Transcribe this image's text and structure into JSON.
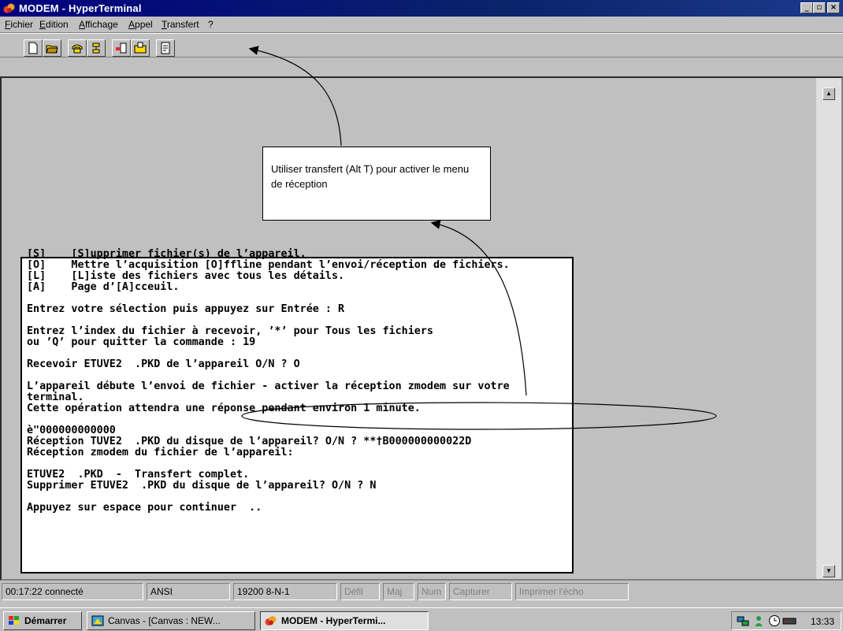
{
  "window": {
    "title": "MODEM - HyperTerminal",
    "controls": {
      "minimize": "_",
      "restore": "▫",
      "close": "×"
    }
  },
  "menu": {
    "items": [
      "Fichier",
      "Edition",
      "Affichage",
      "Appel",
      "Transfert",
      "?"
    ]
  },
  "toolbar": {
    "buttons": [
      "new-icon",
      "open-icon",
      "call-icon",
      "disconnect-icon",
      "send-icon",
      "receive-icon",
      "properties-icon"
    ]
  },
  "terminal": {
    "lines": [
      "[S]    [S]upprimer fichier(s) de l’appareil.",
      "[O]    Mettre l’acquisition [O]ffline pendant l’envoi/réception de fichiers.",
      "[L]    [L]iste des fichiers avec tous les détails.",
      "[A]    Page d’[A]cceuil.",
      "",
      "Entrez votre sélection puis appuyez sur Entrée : R",
      "",
      "Entrez l’index du fichier à recevoir, ’*’ pour Tous les fichiers",
      "ou ’Q’ pour quitter la commande : 19",
      "",
      "Recevoir ETUVE2  .PKD de l’appareil O/N ? O",
      "",
      "L’appareil débute l’envoi de fichier - activer la réception zmodem sur votre",
      "terminal.",
      "Cette opération attendra une réponse pendant environ 1 minute.",
      "",
      "è\"000000000000",
      "Réception TUVE2  .PKD du disque de l’appareil? O/N ? **†B000000000022D",
      "Réception zmodem du fichier de l’appareil:",
      "",
      "ETUVE2  .PKD  -  Transfert complet.",
      "Supprimer ETUVE2  .PKD du disque de l’appareil? O/N ? N",
      "",
      "Appuyez sur espace pour continuer  .."
    ]
  },
  "callout": {
    "text": "Utiliser transfert (Alt T) pour activer le menu de réception"
  },
  "status": {
    "cells": [
      "00:17:22 connecté",
      "ANSI",
      "19200 8-N-1",
      "Défil",
      "Maj",
      "Num",
      "Capturer",
      "Imprimer l'écho"
    ]
  },
  "taskbar": {
    "start": "Démarrer",
    "tasks": [
      "Canvas - [Canvas : NEW...",
      "MODEM - HyperTermi..."
    ],
    "clock": "13:33"
  }
}
